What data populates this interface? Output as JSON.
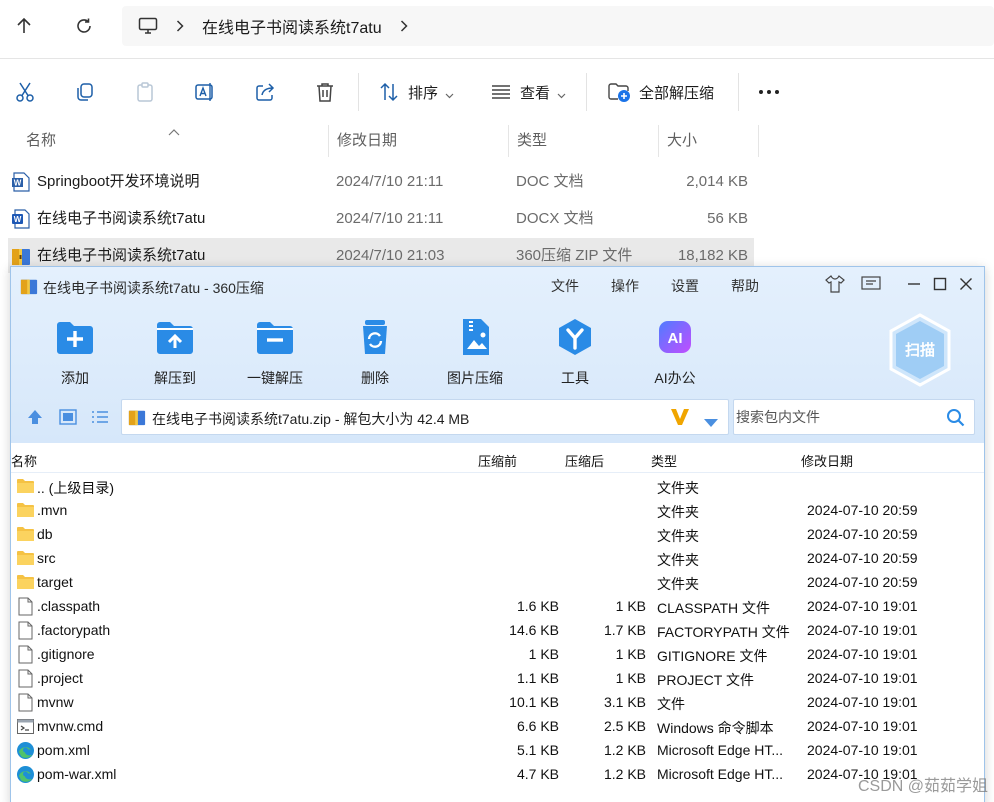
{
  "explorer": {
    "breadcrumb": {
      "current": "在线电子书阅读系统t7atu"
    },
    "commands": {
      "sort_label": "排序",
      "view_label": "查看",
      "extract_all_label": "全部解压缩"
    },
    "columns": {
      "name": "名称",
      "date": "修改日期",
      "type": "类型",
      "size": "大小"
    },
    "files": [
      {
        "name": "Springboot开发环境说明",
        "date": "2024/7/10 21:11",
        "type": "DOC 文档",
        "size": "2,014 KB",
        "icon": "word-doc-icon"
      },
      {
        "name": "在线电子书阅读系统t7atu",
        "date": "2024/7/10 21:11",
        "type": "DOCX 文档",
        "size": "56 KB",
        "icon": "word-docx-icon"
      },
      {
        "name": "在线电子书阅读系统t7atu",
        "date": "2024/7/10 21:03",
        "type": "360压缩 ZIP 文件",
        "size": "18,182 KB",
        "icon": "zip-archive-icon"
      }
    ]
  },
  "zip_window": {
    "title": "在线电子书阅读系统t7atu - 360压缩",
    "menu": [
      "文件",
      "操作",
      "设置",
      "帮助"
    ],
    "scan_badge": "扫描",
    "toolbar": [
      {
        "label": "添加",
        "icon": "add-folder-icon"
      },
      {
        "label": "解压到",
        "icon": "extract-to-icon"
      },
      {
        "label": "一键解压",
        "icon": "one-click-extract-icon"
      },
      {
        "label": "删除",
        "icon": "recycle-delete-icon"
      },
      {
        "label": "图片压缩",
        "icon": "image-compress-icon"
      },
      {
        "label": "工具",
        "icon": "tools-icon"
      },
      {
        "label": "AI办公",
        "icon": "ai-office-icon"
      }
    ],
    "path": "在线电子书阅读系统t7atu.zip - 解包大小为 42.4 MB",
    "search_placeholder": "搜索包内文件",
    "columns": {
      "name": "名称",
      "before": "压缩前",
      "after": "压缩后",
      "type": "类型",
      "date": "修改日期"
    },
    "rows": [
      {
        "name": ".. (上级目录)",
        "before": "",
        "after": "",
        "type": "文件夹",
        "date": "",
        "icon": "folder-icon"
      },
      {
        "name": ".mvn",
        "before": "",
        "after": "",
        "type": "文件夹",
        "date": "2024-07-10 20:59",
        "icon": "folder-icon"
      },
      {
        "name": "db",
        "before": "",
        "after": "",
        "type": "文件夹",
        "date": "2024-07-10 20:59",
        "icon": "folder-icon"
      },
      {
        "name": "src",
        "before": "",
        "after": "",
        "type": "文件夹",
        "date": "2024-07-10 20:59",
        "icon": "folder-icon"
      },
      {
        "name": "target",
        "before": "",
        "after": "",
        "type": "文件夹",
        "date": "2024-07-10 20:59",
        "icon": "folder-icon"
      },
      {
        "name": ".classpath",
        "before": "1.6 KB",
        "after": "1 KB",
        "type": "CLASSPATH 文件",
        "date": "2024-07-10 19:01",
        "icon": "file-icon"
      },
      {
        "name": ".factorypath",
        "before": "14.6 KB",
        "after": "1.7 KB",
        "type": "FACTORYPATH 文件",
        "date": "2024-07-10 19:01",
        "icon": "file-icon"
      },
      {
        "name": ".gitignore",
        "before": "1 KB",
        "after": "1 KB",
        "type": "GITIGNORE 文件",
        "date": "2024-07-10 19:01",
        "icon": "file-icon"
      },
      {
        "name": ".project",
        "before": "1.1 KB",
        "after": "1 KB",
        "type": "PROJECT 文件",
        "date": "2024-07-10 19:01",
        "icon": "file-icon"
      },
      {
        "name": "mvnw",
        "before": "10.1 KB",
        "after": "3.1 KB",
        "type": "文件",
        "date": "2024-07-10 19:01",
        "icon": "file-icon"
      },
      {
        "name": "mvnw.cmd",
        "before": "6.6 KB",
        "after": "2.5 KB",
        "type": "Windows 命令脚本",
        "date": "2024-07-10 19:01",
        "icon": "cmd-script-icon"
      },
      {
        "name": "pom.xml",
        "before": "5.1 KB",
        "after": "1.2 KB",
        "type": "Microsoft Edge HT...",
        "date": "2024-07-10 19:01",
        "icon": "edge-icon"
      },
      {
        "name": "pom-war.xml",
        "before": "4.7 KB",
        "after": "1.2 KB",
        "type": "Microsoft Edge HT...",
        "date": "2024-07-10 19:01",
        "icon": "edge-icon"
      }
    ]
  },
  "watermark": "CSDN @茹茹学姐"
}
